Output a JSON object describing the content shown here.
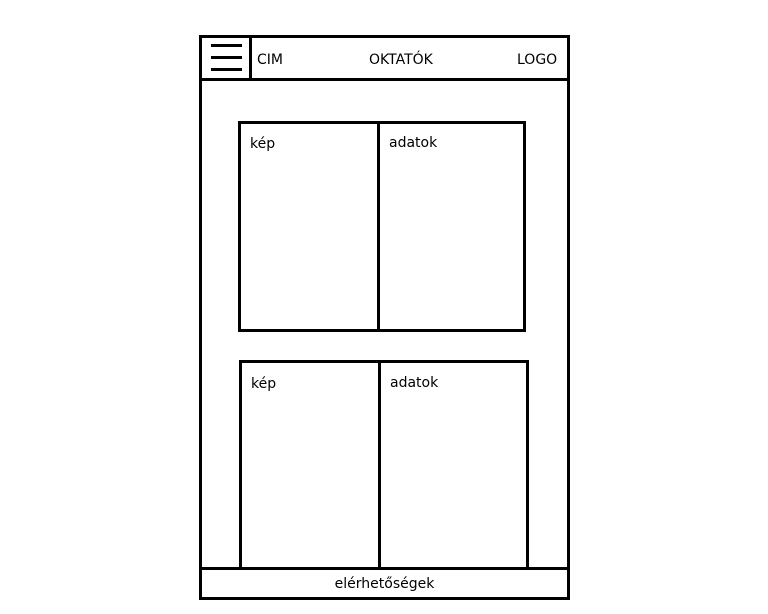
{
  "header": {
    "menu_icon": "hamburger-menu-icon",
    "title": "CIM",
    "nav_label": "OKTATÓK",
    "logo_label": "LOGO"
  },
  "cards": [
    {
      "image_label": "kép",
      "data_label": "adatok"
    },
    {
      "image_label": "kép",
      "data_label": "adatok"
    }
  ],
  "footer": {
    "contacts_label": "elérhetőségek"
  }
}
